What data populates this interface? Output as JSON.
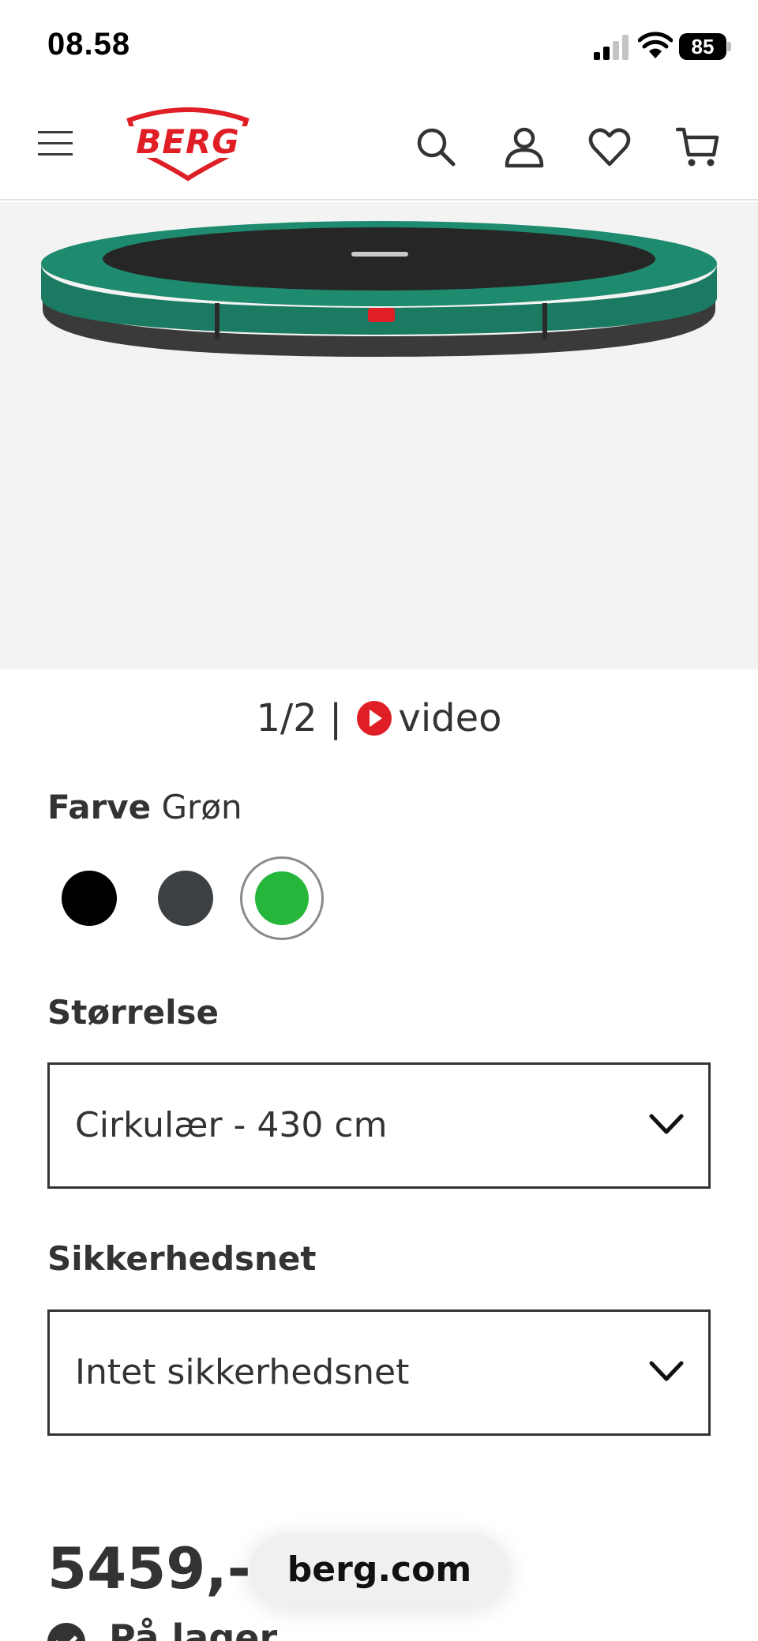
{
  "status_bar": {
    "time": "08.58",
    "battery": "85"
  },
  "header": {
    "logo_text": "BERG"
  },
  "gallery": {
    "counter": "1/2 |",
    "video_label": "video"
  },
  "color": {
    "label": "Farve",
    "selected": "Grøn",
    "swatches": [
      {
        "name": "black",
        "color": "#000000"
      },
      {
        "name": "dark-grey",
        "color": "#3d4144"
      },
      {
        "name": "green",
        "color": "#26b63b"
      }
    ]
  },
  "size": {
    "label": "Størrelse",
    "value": "Cirkulær - 430 cm"
  },
  "safety_net": {
    "label": "Sikkerhedsnet",
    "value": "Intet sikkerhedsnet"
  },
  "price": "5459,-",
  "browser": {
    "url": "berg.com"
  },
  "stock": "På lager",
  "colors": {
    "brand_red": "#e01e26",
    "trampoline_green": "#1e8a6e"
  }
}
